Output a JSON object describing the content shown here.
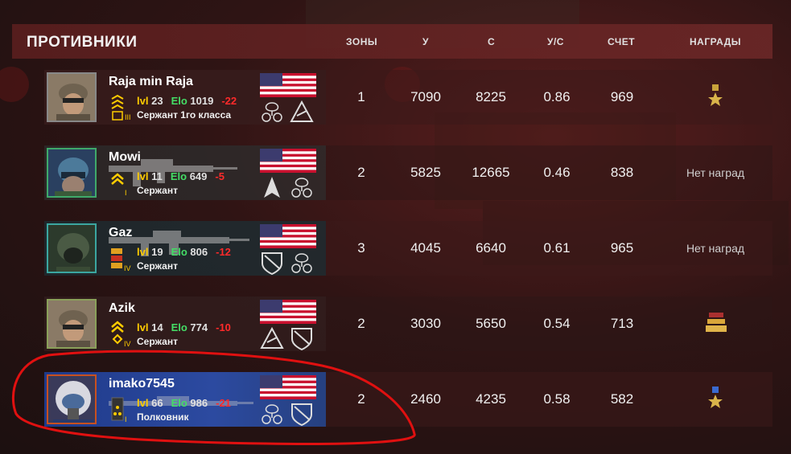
{
  "header": {
    "title": "ПРОТИВНИКИ",
    "columns": {
      "zones": "ЗОНЫ",
      "kills": "У",
      "deaths": "С",
      "kd": "У/С",
      "score": "СЧЕТ",
      "awards": "НАГРАДЫ"
    }
  },
  "labels": {
    "lvl": "lvl",
    "elo": "Elo"
  },
  "players": [
    {
      "name": "Raja min Raja",
      "level": "23",
      "elo": "1019",
      "elo_change": "-22",
      "rank": "Сержант 1го класса",
      "zones": "1",
      "kills": "7090",
      "deaths": "8225",
      "kd": "0.86",
      "score": "969",
      "awards": "",
      "award_icon": "medal-star-icon"
    },
    {
      "name": "Mowi",
      "level": "11",
      "elo": "649",
      "elo_change": "-5",
      "rank": "Сержант",
      "zones": "2",
      "kills": "5825",
      "deaths": "12665",
      "kd": "0.46",
      "score": "838",
      "awards": "Нет наград"
    },
    {
      "name": "Gaz",
      "level": "19",
      "elo": "806",
      "elo_change": "-12",
      "rank": "Сержант",
      "zones": "3",
      "kills": "4045",
      "deaths": "6640",
      "kd": "0.61",
      "score": "965",
      "awards": "Нет наград"
    },
    {
      "name": "Azik",
      "level": "14",
      "elo": "774",
      "elo_change": "-10",
      "rank": "Сержант",
      "zones": "2",
      "kills": "3030",
      "deaths": "5650",
      "kd": "0.54",
      "score": "713",
      "awards": "",
      "award_icon": "gold-bars-icon"
    },
    {
      "name": "imako7545",
      "level": "66",
      "elo": "986",
      "elo_change": "-21",
      "rank": "Полковник",
      "zones": "2",
      "kills": "2460",
      "deaths": "4235",
      "kd": "0.58",
      "score": "582",
      "awards": "",
      "award_icon": "medal-star-icon"
    }
  ],
  "colors": {
    "accent_level": "#ffcc00",
    "accent_elo": "#44dd66",
    "negative": "#ff2a2a",
    "highlight_row": "#2c4aa0",
    "annotation": "#e01010"
  }
}
